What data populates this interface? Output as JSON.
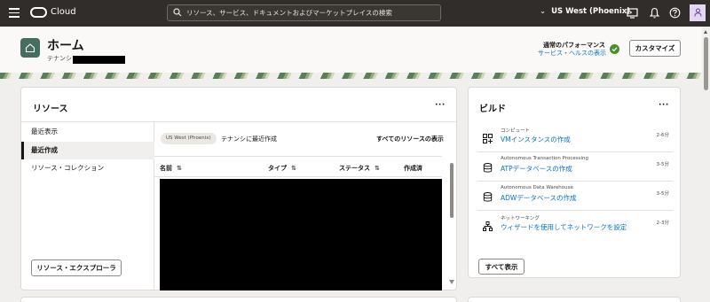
{
  "topbar": {
    "brand": "Cloud",
    "search_placeholder": "リソース、サービス、ドキュメントおよびマーケットプレイスの検索",
    "region": "US West (Phoenix)",
    "region_chevron": "⌄",
    "avatar_icon": "person-icon"
  },
  "header": {
    "title": "ホーム",
    "tenancy_label": "テナンシ",
    "performance_label": "通常のパフォーマンス",
    "service_health_link": "サービス・ヘルスの表示",
    "customize_button": "カスタマイズ"
  },
  "resources": {
    "title": "リソース",
    "more": "···",
    "nav": [
      "最近表示",
      "最近作成",
      "リソース・コレクション"
    ],
    "active_nav_index": 1,
    "explorer_button": "リソース・エクスプローラ",
    "region_chip": "US West (Phoenix)",
    "recent_text": "テナンシに最近作成",
    "view_all": "すべてのリソースの表示",
    "columns": [
      "名前",
      "タイプ",
      "ステータス",
      "作成済"
    ],
    "sort_glyph": "⇅"
  },
  "build": {
    "title": "ビルド",
    "more": "···",
    "items": [
      {
        "category": "コンピュート",
        "link": "VMインスタンスの作成",
        "time": "2-6分",
        "icon": "compute-icon"
      },
      {
        "category": "Autonomous Transaction Processing",
        "link": "ATPデータベースの作成",
        "time": "3-5分",
        "icon": "database-icon"
      },
      {
        "category": "Autonomous Data Warehouse",
        "link": "ADWデータベースの作成",
        "time": "3-5分",
        "icon": "database-icon"
      },
      {
        "category": "ネットワーキング",
        "link": "ウィザードを使用してネットワークを設定",
        "time": "2-3分",
        "icon": "network-icon"
      }
    ],
    "show_all": "すべて表示"
  },
  "colors": {
    "topbar": "#312d2a",
    "link": "#0572ce",
    "home_badge": "#456d60",
    "ok_check": "#4a8f28"
  }
}
